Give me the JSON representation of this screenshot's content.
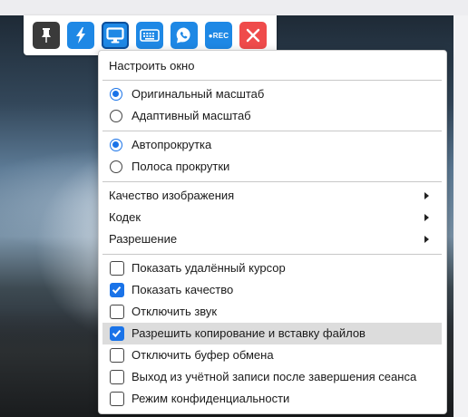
{
  "toolbar": {
    "pin_icon": "pin-icon",
    "bolt_icon": "lightning-icon",
    "display_icon": "display-icon",
    "keyboard_icon": "keyboard-icon",
    "chat_icon": "chat-phone-icon",
    "rec_label": "●REC",
    "close_icon": "close-icon"
  },
  "menu": {
    "title": "Настроить окно",
    "scale_original": "Оригинальный масштаб",
    "scale_adaptive": "Адаптивный масштаб",
    "autoscroll": "Автопрокрутка",
    "scrollbar": "Полоса прокрутки",
    "image_quality": "Качество изображения",
    "codec": "Кодек",
    "resolution": "Разрешение",
    "show_remote_cursor": "Показать удалённый курсор",
    "show_quality": "Показать качество",
    "mute": "Отключить звук",
    "allow_file_copy": "Разрешить копирование и вставку файлов",
    "disable_clipboard": "Отключить буфер обмена",
    "logout_after_session": "Выход из учётной записи после завершения сеанса",
    "privacy_mode": "Режим конфиденциальности"
  },
  "state": {
    "scale": "original",
    "scroll": "autoscroll",
    "show_remote_cursor": false,
    "show_quality": true,
    "mute": false,
    "allow_file_copy": true,
    "disable_clipboard": false,
    "logout_after_session": false,
    "privacy_mode": false
  },
  "colors": {
    "accent": "#1a73e8",
    "toolbar_blue": "#1e88e5",
    "close_red": "#ef4b4b",
    "highlight": "#dcdcdc"
  }
}
